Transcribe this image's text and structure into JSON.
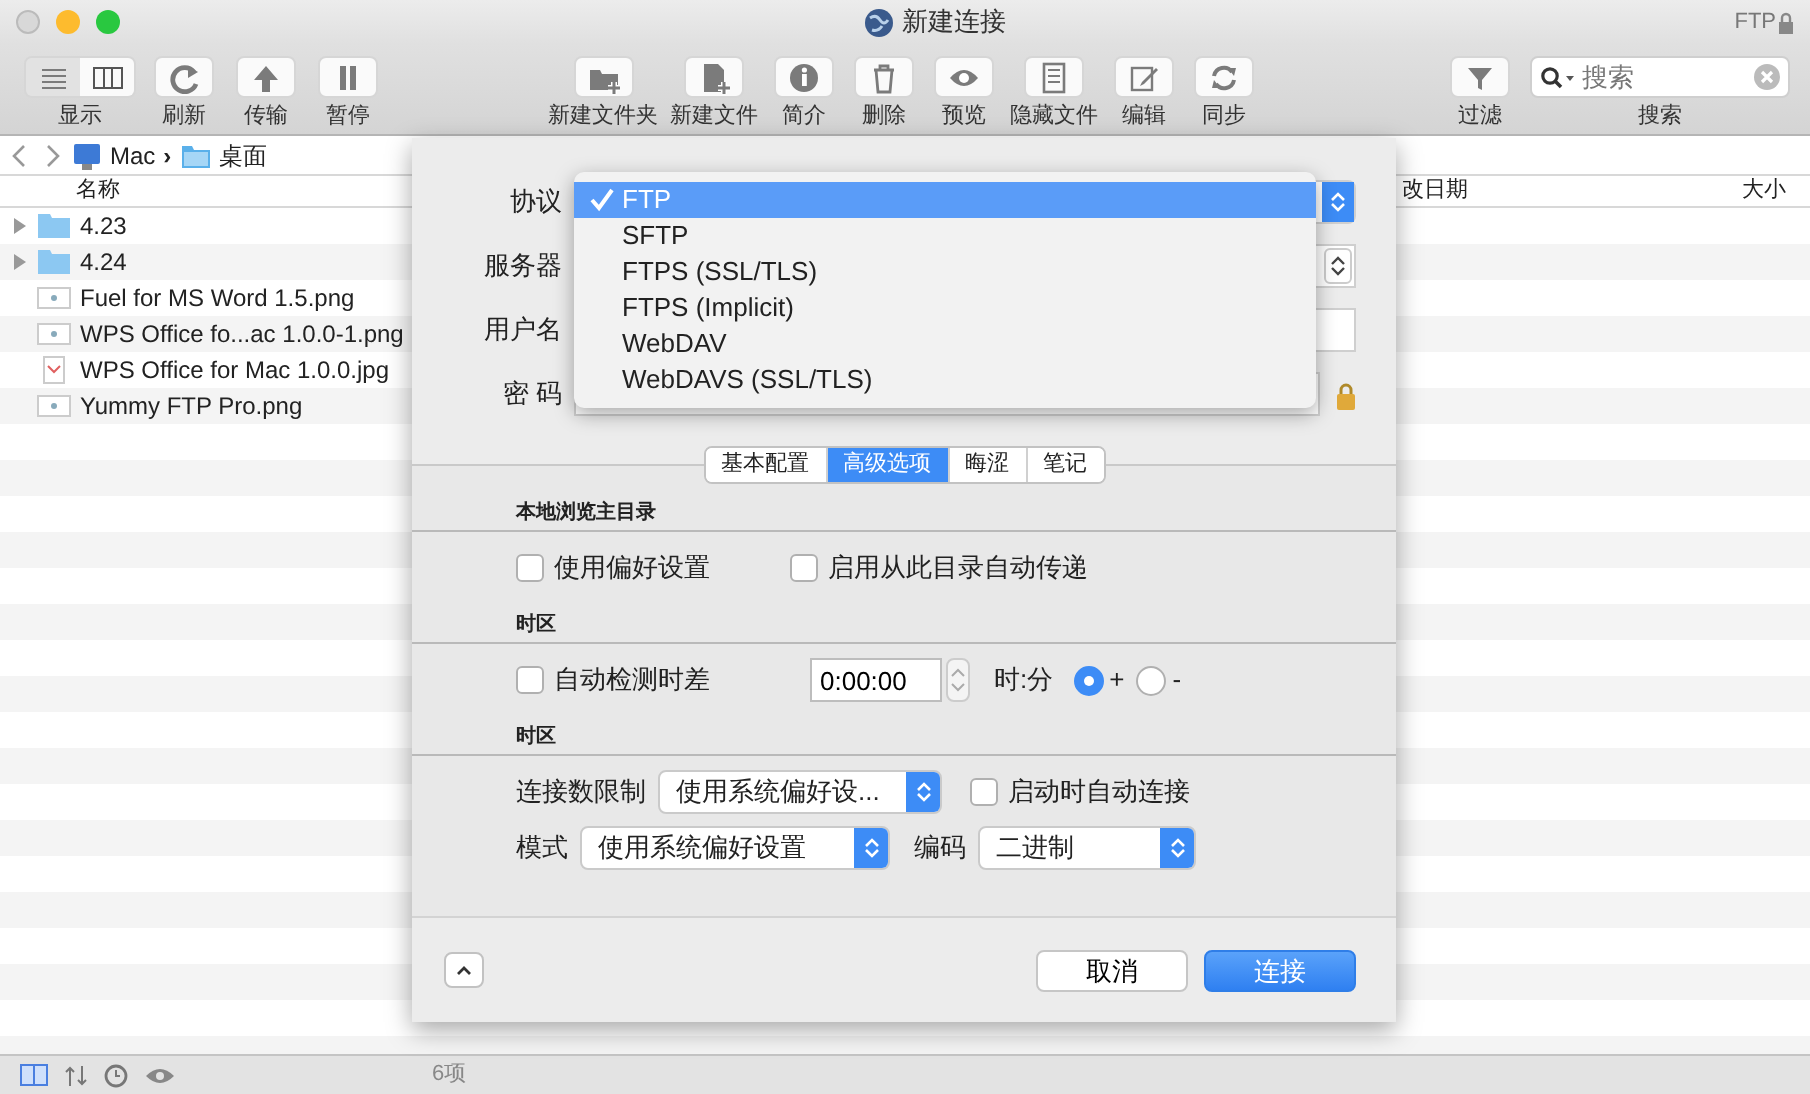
{
  "window": {
    "title": "新建连接",
    "badge": "FTP"
  },
  "toolbar": [
    {
      "label": "显示",
      "kind": "segmented",
      "segments": [
        {
          "selected": true
        },
        {
          "selected": false
        }
      ]
    },
    {
      "label": "刷新",
      "kind": "button"
    },
    {
      "label": "传输",
      "kind": "button"
    },
    {
      "label": "暂停",
      "kind": "button"
    },
    {
      "label": "新建文件夹",
      "kind": "button"
    },
    {
      "label": "新建文件",
      "kind": "button"
    },
    {
      "label": "简介",
      "kind": "button"
    },
    {
      "label": "删除",
      "kind": "button"
    },
    {
      "label": "预览",
      "kind": "button"
    },
    {
      "label": "隐藏文件",
      "kind": "button"
    },
    {
      "label": "编辑",
      "kind": "button"
    },
    {
      "label": "同步",
      "kind": "button"
    },
    {
      "label": "过滤",
      "kind": "button"
    },
    {
      "label": "搜索",
      "kind": "search",
      "placeholder": "搜索"
    }
  ],
  "path": [
    {
      "label": "Mac",
      "kind": "computer"
    },
    {
      "label": "桌面",
      "kind": "folder"
    }
  ],
  "path_separator": "›",
  "columns": [
    "名称",
    "改日期",
    "大小"
  ],
  "files": [
    {
      "name": "4.23",
      "kind": "folder"
    },
    {
      "name": "4.24",
      "kind": "folder"
    },
    {
      "name": "Fuel for MS Word 1.5.png",
      "kind": "image"
    },
    {
      "name": "WPS Office fo...ac 1.0.0-1.png",
      "kind": "image"
    },
    {
      "name": "WPS Office for Mac 1.0.0.jpg",
      "kind": "photo"
    },
    {
      "name": "Yummy FTP Pro.png",
      "kind": "image"
    }
  ],
  "status_bar": {
    "count": "6项"
  },
  "dialog": {
    "fields": [
      {
        "label": "协议",
        "kind": "popup"
      },
      {
        "label": "服务器",
        "kind": "combo"
      },
      {
        "label": "用户名",
        "kind": "text"
      },
      {
        "label": "密 码",
        "kind": "password"
      }
    ],
    "protocol_menu": [
      {
        "label": "FTP",
        "selected": true
      },
      {
        "label": "SFTP",
        "selected": false
      },
      {
        "label": "FTPS (SSL/TLS)",
        "selected": false
      },
      {
        "label": "FTPS (Implicit)",
        "selected": false
      },
      {
        "label": "WebDAV",
        "selected": false
      },
      {
        "label": "WebDAVS (SSL/TLS)",
        "selected": false
      }
    ],
    "tabs": [
      {
        "label": "基本配置",
        "selected": false
      },
      {
        "label": "高级选项",
        "selected": true
      },
      {
        "label": "晦涩",
        "selected": false
      },
      {
        "label": "笔记",
        "selected": false
      }
    ],
    "sections": [
      {
        "heading": "本地浏览主目录",
        "rows": [
          {
            "controls": [
              {
                "kind": "checkbox",
                "label": "使用偏好设置",
                "checked": false
              },
              {
                "kind": "checkbox",
                "label": "启用从此目录自动传递",
                "checked": false
              }
            ]
          }
        ]
      },
      {
        "heading": "时区",
        "rows": [
          {
            "controls": [
              {
                "kind": "checkbox",
                "label": "自动检测时差",
                "checked": false
              },
              {
                "kind": "time",
                "value": "0:00:00"
              },
              {
                "kind": "label",
                "label": "时:分"
              },
              {
                "kind": "radio",
                "label": "+",
                "selected": true
              },
              {
                "kind": "radio",
                "label": "-",
                "selected": false
              }
            ]
          }
        ]
      },
      {
        "heading": "时区",
        "rows": [
          {
            "controls": [
              {
                "kind": "label",
                "label": "连接数限制"
              },
              {
                "kind": "select",
                "value": "使用系统偏好设..."
              },
              {
                "kind": "checkbox",
                "label": "启动时自动连接",
                "checked": false
              }
            ]
          },
          {
            "controls": [
              {
                "kind": "label",
                "label": "模式"
              },
              {
                "kind": "select",
                "value": "使用系统偏好设置"
              },
              {
                "kind": "label",
                "label": "编码"
              },
              {
                "kind": "select",
                "value": "二进制"
              }
            ]
          }
        ]
      }
    ],
    "buttons": [
      {
        "label": "取消",
        "kind": "default"
      },
      {
        "label": "连接",
        "kind": "primary"
      }
    ]
  }
}
